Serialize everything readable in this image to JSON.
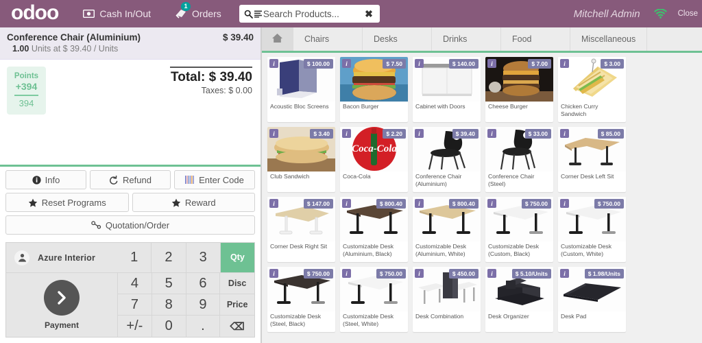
{
  "header": {
    "logo": "odoo",
    "cash_in_out": "Cash In/Out",
    "orders": "Orders",
    "orders_badge": "1",
    "search_placeholder": "Search Products...",
    "search_value": "",
    "clear_icon": "✖",
    "username": "Mitchell Admin",
    "close_label": "Close",
    "brand_color": "#875A7B",
    "accent_green": "#6ec193"
  },
  "order": {
    "lines": [
      {
        "name": "Conference Chair (Aluminium)",
        "price": "$ 39.40",
        "qty": "1.00",
        "detail": "Units at $ 39.40 / Units"
      }
    ],
    "points": {
      "label": "Points",
      "delta": "+394",
      "total": "394"
    },
    "totals": {
      "total_label": "Total: $ 39.40",
      "taxes_label": "Taxes: $ 0.00"
    }
  },
  "actions": {
    "row1": [
      {
        "label": "Info",
        "icon": "info-icon"
      },
      {
        "label": "Refund",
        "icon": "refund-icon"
      },
      {
        "label": "Enter Code",
        "icon": "barcode-icon"
      }
    ],
    "row2": [
      {
        "label": "Reset Programs",
        "icon": "star-icon"
      },
      {
        "label": "Reward",
        "icon": "star-icon"
      }
    ],
    "row3": [
      {
        "label": "Quotation/Order",
        "icon": "link-icon"
      }
    ]
  },
  "numpad": {
    "customer": "Azure Interior",
    "payment_label": "Payment",
    "payment_icon": "chevron-right-icon",
    "keys_top": [
      "1",
      "2",
      "3",
      "Qty"
    ],
    "rows": [
      [
        "4",
        "5",
        "6",
        "Disc"
      ],
      [
        "7",
        "8",
        "9",
        "Price"
      ],
      [
        "+/-",
        "0",
        ".",
        "⌫"
      ]
    ],
    "active_mode": "Qty"
  },
  "categories": [
    {
      "label": "",
      "icon": "home-icon",
      "active": true
    },
    {
      "label": "Chairs",
      "icon": "",
      "active": false
    },
    {
      "label": "Desks",
      "icon": "",
      "active": false
    },
    {
      "label": "Drinks",
      "icon": "",
      "active": false
    },
    {
      "label": "Food",
      "icon": "",
      "active": false
    },
    {
      "label": "Miscellaneous",
      "icon": "",
      "active": false
    }
  ],
  "products": [
    {
      "name": "Acoustic Bloc Screens",
      "price": "$ 100.00",
      "art": "screens"
    },
    {
      "name": "Bacon Burger",
      "price": "$ 7.50",
      "art": "burger-bacon"
    },
    {
      "name": "Cabinet with Doors",
      "price": "$ 140.00",
      "art": "cabinet"
    },
    {
      "name": "Cheese Burger",
      "price": "$ 7.00",
      "art": "burger-cheese"
    },
    {
      "name": "Chicken Curry Sandwich",
      "price": "$ 3.00",
      "art": "sandwich-curry"
    },
    {
      "name": "Club Sandwich",
      "price": "$ 3.40",
      "art": "sandwich-club"
    },
    {
      "name": "Coca-Cola",
      "price": "$ 2.20",
      "art": "cola"
    },
    {
      "name": "Conference Chair (Aluminium)",
      "price": "$ 39.40",
      "art": "chair"
    },
    {
      "name": "Conference Chair (Steel)",
      "price": "$ 33.00",
      "art": "chair"
    },
    {
      "name": "Corner Desk Left Sit",
      "price": "$ 85.00",
      "art": "desk-wood-black"
    },
    {
      "name": "Corner Desk Right Sit",
      "price": "$ 147.00",
      "art": "desk-wood-white"
    },
    {
      "name": "Customizable Desk (Aluminium, Black)",
      "price": "$ 800.40",
      "art": "desk-dark-black"
    },
    {
      "name": "Customizable Desk (Aluminium, White)",
      "price": "$ 800.40",
      "art": "desk-wood-black"
    },
    {
      "name": "Customizable Desk (Custom, Black)",
      "price": "$ 750.00",
      "art": "desk-white-black"
    },
    {
      "name": "Customizable Desk (Custom, White)",
      "price": "$ 750.00",
      "art": "desk-white-black"
    },
    {
      "name": "Customizable Desk (Steel, Black)",
      "price": "$ 750.00",
      "art": "desk-dark-black"
    },
    {
      "name": "Customizable Desk (Steel, White)",
      "price": "$ 750.00",
      "art": "desk-white-black"
    },
    {
      "name": "Desk Combination",
      "price": "$ 450.00",
      "art": "desk-combination"
    },
    {
      "name": "Desk Organizer",
      "price": "$ 5.10/Units",
      "art": "organizer"
    },
    {
      "name": "Desk Pad",
      "price": "$ 1.98/Units",
      "art": "deskpad"
    }
  ]
}
